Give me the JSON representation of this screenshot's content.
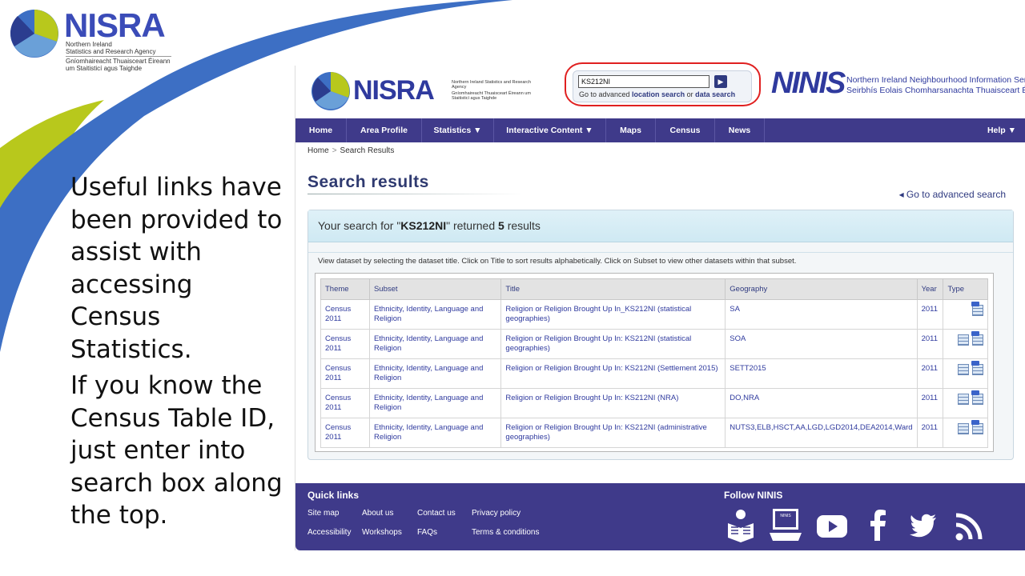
{
  "slide": {
    "logo": {
      "wordmark": "NISRA",
      "line1": "Northern Ireland",
      "line2": "Statistics and Research Agency",
      "line3": "Gníomhaireacht Thuaisceart Éireann",
      "line4": "um Staitisticí agus Taighde"
    },
    "paragraphs": [
      "Useful links have been provided to assist with accessing Census Statistics.",
      "If you know the Census Table ID, just enter into search box along the top."
    ],
    "colors": {
      "swoosh_blue": "#3d6fc4",
      "swoosh_green": "#b8c81c"
    }
  },
  "site": {
    "header": {
      "logo_wordmark": "NISRA",
      "logo_sub1": "Northern Ireland Statistics and Research Agency",
      "logo_sub2": "Gníomhaireacht Thuaisceart Éireann um Staitisticí agus Taighde",
      "search_value": "KS212NI",
      "adv_prefix": "Go to advanced ",
      "adv_location": "location search",
      "adv_or": " or ",
      "adv_data": "data search",
      "ninis_logo": "NINIS",
      "ninis_line1": "Northern Ireland Neighbourhood Information Service",
      "ninis_line2": "Seirbhís Eolais Chomharsanachta Thuaisceart Éireann"
    },
    "nav": {
      "items": [
        "Home",
        "Area Profile",
        "Statistics  ▼",
        "Interactive Content  ▼",
        "Maps",
        "Census",
        "News"
      ],
      "help": "Help  ▼"
    },
    "breadcrumb": {
      "home": "Home",
      "sep": ">",
      "current": "Search Results"
    },
    "page_title": "Search results",
    "adv_search_link": "◂  Go to advanced search",
    "results": {
      "prefix": "Your search for \"",
      "query": "KS212NI",
      "mid": "\" returned ",
      "count": "5",
      "suffix": " results",
      "note": "View dataset by selecting the dataset title. Click on Title to sort results alphabetically. Click on Subset to view other datasets within that subset.",
      "columns": [
        "Theme",
        "Subset",
        "Title",
        "Geography",
        "Year",
        "Type"
      ],
      "rows": [
        {
          "theme": "Census 2011",
          "subset": "Ethnicity, Identity, Language and Religion",
          "title": "Religion or Religion Brought Up In_KS212NI (statistical geographies)",
          "geography": "SA",
          "year": "2011",
          "types": [
            "xls-icon"
          ]
        },
        {
          "theme": "Census 2011",
          "subset": "Ethnicity, Identity, Language and Religion",
          "title": "Religion or Religion Brought Up In: KS212NI (statistical geographies)",
          "geography": "SOA",
          "year": "2011",
          "types": [
            "table-icon",
            "xls-icon"
          ]
        },
        {
          "theme": "Census 2011",
          "subset": "Ethnicity, Identity, Language and Religion",
          "title": "Religion or Religion Brought Up In: KS212NI (Settlement 2015)",
          "geography": "SETT2015",
          "year": "2011",
          "types": [
            "table-icon",
            "xls-icon"
          ]
        },
        {
          "theme": "Census 2011",
          "subset": "Ethnicity, Identity, Language and Religion",
          "title": "Religion or Religion Brought Up In: KS212NI (NRA)",
          "geography": "DO,NRA",
          "year": "2011",
          "types": [
            "table-icon",
            "xls-icon"
          ]
        },
        {
          "theme": "Census 2011",
          "subset": "Ethnicity, Identity, Language and Religion",
          "title": "Religion or Religion Brought Up In: KS212NI (administrative geographies)",
          "geography": "NUTS3,ELB,HSCT,AA,LGD,LGD2014,DEA2014,Ward",
          "year": "2011",
          "types": [
            "table-icon",
            "xls-icon"
          ]
        }
      ]
    },
    "footer": {
      "quick_links_title": "Quick links",
      "links_row1": [
        "Site map",
        "About us",
        "Contact us",
        "Privacy policy"
      ],
      "links_row2": [
        "Accessibility",
        "Workshops",
        "FAQs",
        "Terms & conditions"
      ],
      "follow_title": "Follow NINIS",
      "social_icons": [
        "reader-icon",
        "ninis-laptop-icon",
        "youtube-icon",
        "facebook-icon",
        "twitter-icon",
        "rss-icon"
      ],
      "laptop_label": "NINIS"
    },
    "colors": {
      "nav_bg": "#3f3a8a",
      "link": "#2f3a9e",
      "highlight_ring": "#e02020"
    }
  }
}
